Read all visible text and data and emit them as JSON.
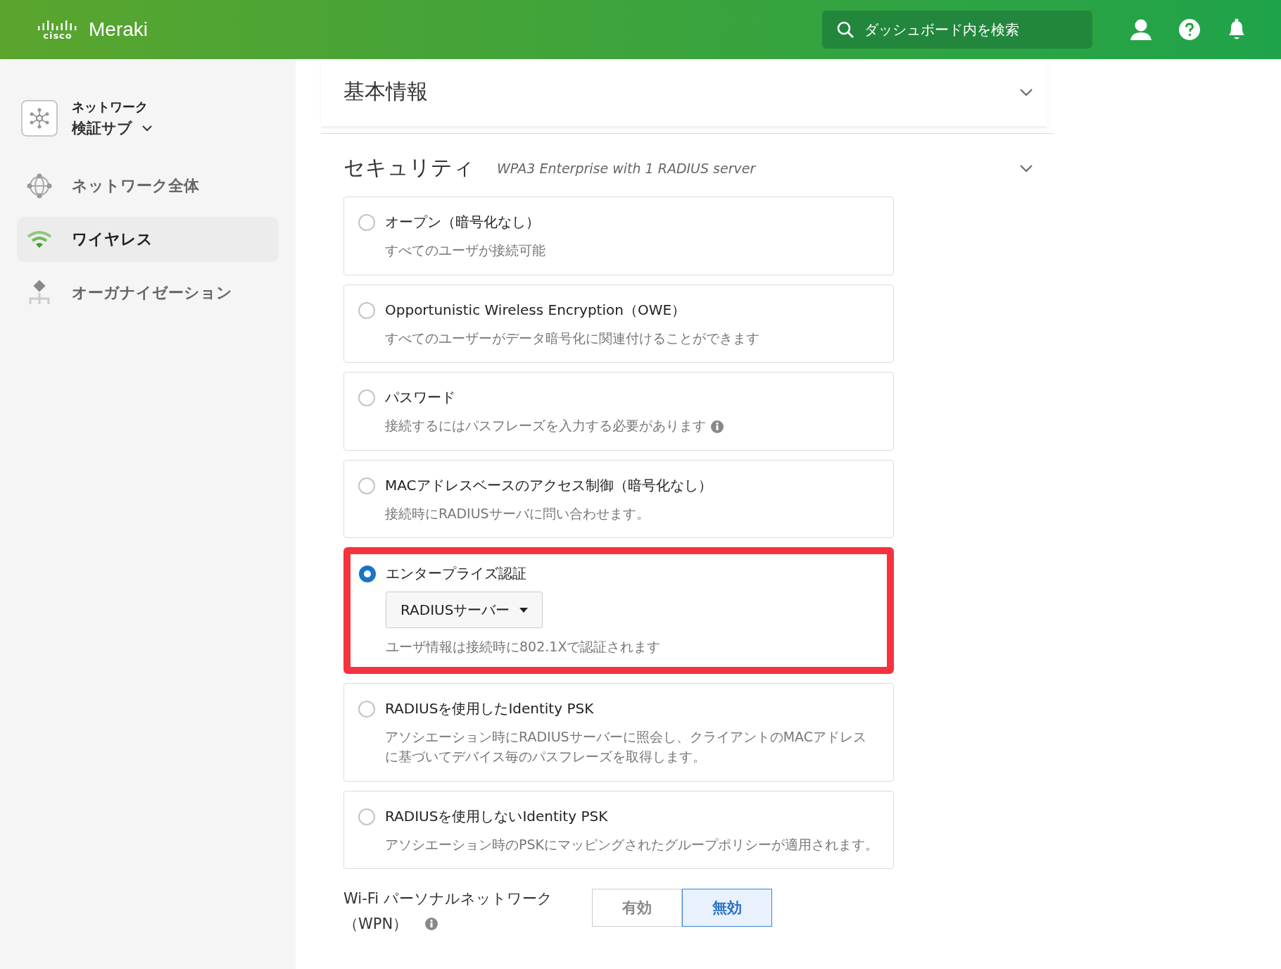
{
  "header": {
    "logo_mark": "cisco",
    "product": "Meraki",
    "search": {
      "placeholder": "ダッシュボード内を検索"
    }
  },
  "sidebar": {
    "network_selector": {
      "line1": "ネットワーク",
      "line2": "検証サブ"
    },
    "items": [
      {
        "label": "ネットワーク全体",
        "kind": "globe",
        "selected": false
      },
      {
        "label": "ワイヤレス",
        "kind": "wifi",
        "selected": true
      },
      {
        "label": "オーガナイゼーション",
        "kind": "org",
        "selected": false
      }
    ]
  },
  "sections": [
    {
      "title": "基本情報"
    },
    {
      "title": "セキュリティ",
      "summary": "WPA3 Enterprise with 1 RADIUS server"
    }
  ],
  "security_options": [
    {
      "title": "オープン（暗号化なし）",
      "description": "すべてのユーザが接続可能",
      "selected": false,
      "highlighted": false
    },
    {
      "title": "Opportunistic Wireless Encryption（OWE）",
      "description": "すべてのユーザーがデータ暗号化に関連付けることができます",
      "selected": false,
      "highlighted": false
    },
    {
      "title": "パスワード",
      "description": "接続するにはパスフレーズを入力する必要があります",
      "info": true,
      "selected": false,
      "highlighted": false
    },
    {
      "title": "MACアドレスベースのアクセス制御（暗号化なし）",
      "description": "接続時にRADIUSサーバに問い合わせます。",
      "selected": false,
      "highlighted": false
    },
    {
      "title": "エンタープライズ認証",
      "dropdown": "RADIUSサーバー",
      "description": "ユーザ情報は接続時に802.1Xで認証されます",
      "selected": true,
      "highlighted": true
    },
    {
      "title": "RADIUSを使用したIdentity PSK",
      "description": "アソシエーション時にRADIUSサーバーに照会し、クライアントのMACアドレスに基づいてデバイス毎のパスフレーズを取得します。",
      "selected": false,
      "highlighted": false
    },
    {
      "title": "RADIUSを使用しないIdentity PSK",
      "description": "アソシエーション時のPSKにマッピングされたグループポリシーが適用されます。",
      "selected": false,
      "highlighted": false
    }
  ],
  "wpn": {
    "label_line1": "Wi-Fi パーソナルネットワーク",
    "label_line2": "（WPN）",
    "options": [
      {
        "label": "有効",
        "selected": false
      },
      {
        "label": "無効",
        "selected": true
      }
    ]
  }
}
